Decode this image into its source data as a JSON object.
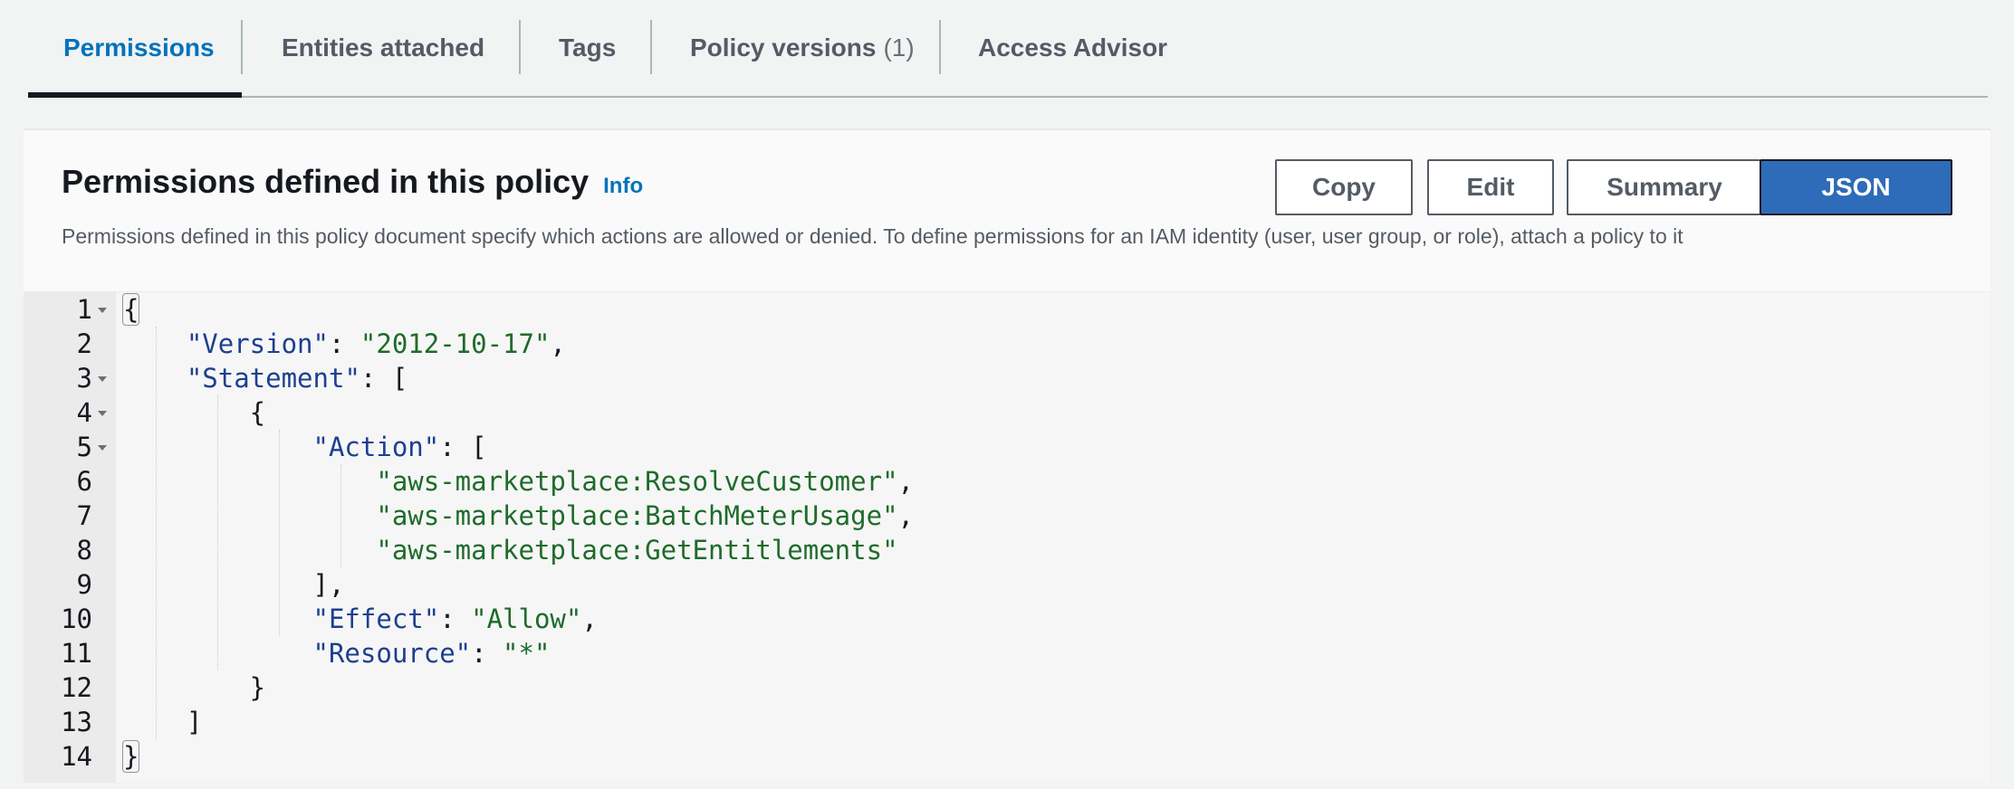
{
  "tabs": [
    {
      "label": "Permissions",
      "active": true
    },
    {
      "label": "Entities attached"
    },
    {
      "label": "Tags"
    },
    {
      "label": "Policy versions",
      "count": "(1)"
    },
    {
      "label": "Access Advisor"
    }
  ],
  "panel": {
    "title": "Permissions defined in this policy",
    "info_label": "Info",
    "description": "Permissions defined in this policy document specify which actions are allowed or denied. To define permissions for an IAM identity (user, user group, or role), attach a policy to it",
    "buttons": {
      "copy": "Copy",
      "edit": "Edit",
      "summary": "Summary",
      "json": "JSON"
    },
    "view_mode": "JSON"
  },
  "code": {
    "line_numbers": [
      "1",
      "2",
      "3",
      "4",
      "5",
      "6",
      "7",
      "8",
      "9",
      "10",
      "11",
      "12",
      "13",
      "14"
    ],
    "foldable_lines": [
      "1",
      "3",
      "4",
      "5"
    ],
    "tokens": {
      "open_brace": "{",
      "close_brace": "}",
      "version_key": "\"Version\"",
      "version_value": "\"2012-10-17\"",
      "statement_key": "\"Statement\"",
      "action_key": "\"Action\"",
      "action_1": "\"aws-marketplace:ResolveCustomer\"",
      "action_2": "\"aws-marketplace:BatchMeterUsage\"",
      "action_3": "\"aws-marketplace:GetEntitlements\"",
      "effect_key": "\"Effect\"",
      "effect_value": "\"Allow\"",
      "resource_key": "\"Resource\"",
      "resource_value": "\"*\""
    }
  },
  "colors": {
    "active_tab": "#0073bb",
    "json_key": "#1d3f8f",
    "json_string": "#1e6b2a",
    "selected_button": "#2e6bb8"
  }
}
